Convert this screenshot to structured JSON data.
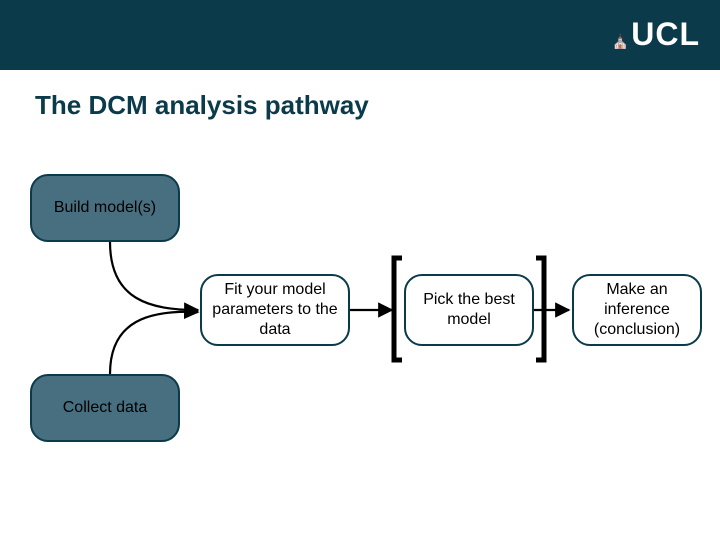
{
  "brand": {
    "name": "UCL",
    "dome_glyph": "⛪"
  },
  "title": "The DCM analysis pathway",
  "nodes": {
    "build": {
      "label": "Build model(s)"
    },
    "collect": {
      "label": "Collect data"
    },
    "fit": {
      "label": "Fit your model parameters to the data"
    },
    "pick": {
      "label": "Pick the best model"
    },
    "infer": {
      "label": "Make an inference (conclusion)"
    }
  },
  "colors": {
    "header": "#0b3a4a",
    "node_fill_dark": "#486f7f",
    "node_border": "#0b3a4a"
  }
}
